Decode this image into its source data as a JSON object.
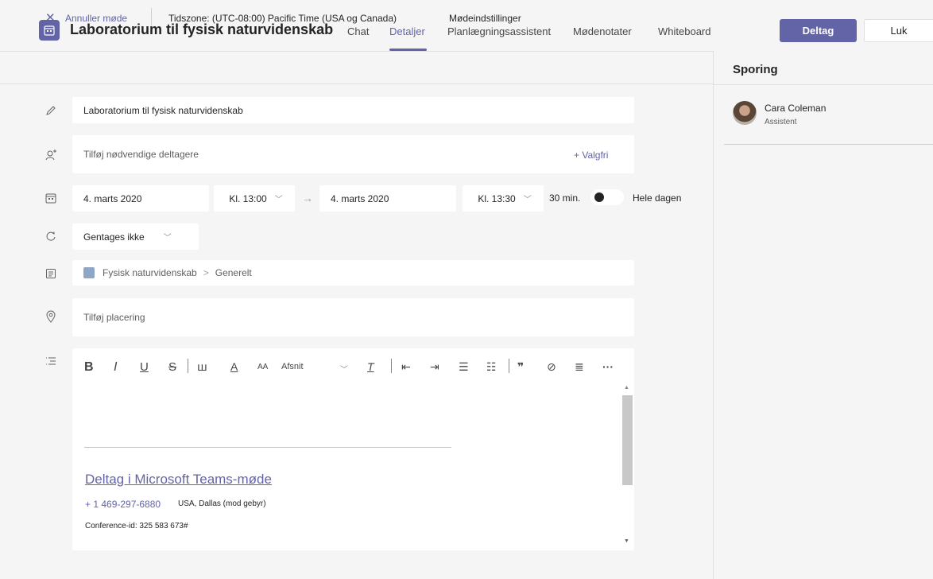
{
  "header": {
    "title": "Laboratorium til fysisk naturvidenskab",
    "tabs": [
      {
        "label": "Chat",
        "active": false
      },
      {
        "label": "Detaljer",
        "active": true
      },
      {
        "label": "Planlægningsassistent",
        "active": false
      },
      {
        "label": "Mødenotater",
        "active": false
      },
      {
        "label": "Whiteboard",
        "active": false
      }
    ],
    "join_label": "Deltag",
    "close_label": "Luk"
  },
  "subbar": {
    "cancel_label": "Annuller møde",
    "timezone": "Tidszone: (UTC-08:00) Pacific Time (USA og Canada)",
    "meeting_options": "Mødeindstillinger"
  },
  "form": {
    "title_value": "Laboratorium til fysisk naturvidenskab",
    "attendees_placeholder": "Tilføj nødvendige deltagere",
    "optional_label": "+ Valgfri",
    "start_date": "4. marts 2020",
    "start_time": "Kl. 13:00",
    "end_date": "4. marts 2020",
    "end_time": "Kl. 13:30",
    "duration": "30 min.",
    "all_day_label": "Hele dagen",
    "all_day_on": false,
    "repeat": "Gentages ikke",
    "channel": "Fysisk naturvidenskab",
    "channel_sub": "Generelt",
    "location_placeholder": "Tilføj placering"
  },
  "editor": {
    "toolbar": {
      "bold": "B",
      "italic": "I",
      "underline": "U",
      "strike": "S",
      "highlight": "ꟺ",
      "font_color": "A",
      "font_size": "AA",
      "paragraph": "Afsnit",
      "clear_format": "T",
      "outdent": "⇤",
      "indent": "⇥",
      "bullets": "☰",
      "numbered": "☷",
      "quote": "❞",
      "link": "⊘",
      "align": "≣",
      "more": "···"
    },
    "join_link": "Deltag i Microsoft Teams-møde",
    "phone": "+ 1 469-297-6880",
    "phone_location": "USA, Dallas (mod gebyr)",
    "conference_id": "Conference-id: 325 583 673#"
  },
  "tracking": {
    "title": "Sporing",
    "people": [
      {
        "name": "Cara Coleman",
        "role": "Assistent"
      }
    ]
  },
  "colors": {
    "accent": "#6264a7",
    "background": "#f5f5f5",
    "field": "#ffffff"
  }
}
